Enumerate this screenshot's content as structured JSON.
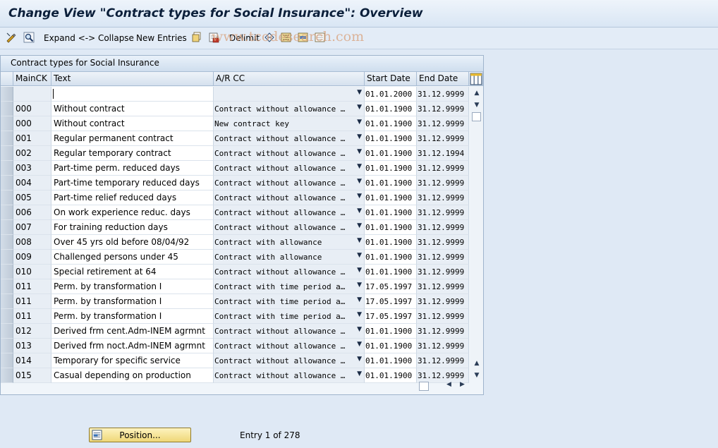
{
  "window": {
    "title": "Change View \"Contract types for Social Insurance\": Overview"
  },
  "toolbar": {
    "expand_collapse": "Expand <-> Collapse",
    "new_entries": "New Entries",
    "delimit": "Delimit"
  },
  "watermark": "www.tcodesearch.com",
  "table": {
    "title": "Contract types for Social Insurance",
    "columns": [
      "MainCK",
      "Text",
      "A/R CC",
      "Start Date",
      "End Date"
    ],
    "rows": [
      [
        "",
        "",
        "",
        "01.01.2000",
        "31.12.9999"
      ],
      [
        "000",
        "Without contract",
        "Contract without allowance …",
        "01.01.1900",
        "31.12.9999"
      ],
      [
        "000",
        "Without contract",
        "New contract key",
        "01.01.1900",
        "31.12.9999"
      ],
      [
        "001",
        "Regular permanent contract",
        "Contract without allowance …",
        "01.01.1900",
        "31.12.9999"
      ],
      [
        "002",
        "Regular temporary contract",
        "Contract without allowance …",
        "01.01.1900",
        "31.12.1994"
      ],
      [
        "003",
        "Part-time perm. reduced days",
        "Contract without allowance …",
        "01.01.1900",
        "31.12.9999"
      ],
      [
        "004",
        "Part-time temporary reduced days",
        "Contract without allowance …",
        "01.01.1900",
        "31.12.9999"
      ],
      [
        "005",
        "Part-time relief reduced days",
        "Contract without allowance …",
        "01.01.1900",
        "31.12.9999"
      ],
      [
        "006",
        "On work experience reduc. days",
        "Contract without allowance …",
        "01.01.1900",
        "31.12.9999"
      ],
      [
        "007",
        "For training reduction days",
        "Contract without allowance …",
        "01.01.1900",
        "31.12.9999"
      ],
      [
        "008",
        "Over 45 yrs old before 08/04/92",
        "Contract with allowance",
        "01.01.1900",
        "31.12.9999"
      ],
      [
        "009",
        "Challenged persons under 45",
        "Contract with allowance",
        "01.01.1900",
        "31.12.9999"
      ],
      [
        "010",
        "Special retirement at 64",
        "Contract without allowance …",
        "01.01.1900",
        "31.12.9999"
      ],
      [
        "011",
        "Perm. by transformation I",
        "Contract with time period a…",
        "17.05.1997",
        "31.12.9999"
      ],
      [
        "011",
        "Perm. by transformation I",
        "Contract with time period a…",
        "17.05.1997",
        "31.12.9999"
      ],
      [
        "011",
        "Perm. by transformation I",
        "Contract with time period a…",
        "17.05.1997",
        "31.12.9999"
      ],
      [
        "012",
        "Derived frm cent.Adm-INEM agrmnt",
        "Contract without allowance …",
        "01.01.1900",
        "31.12.9999"
      ],
      [
        "013",
        "Derived frm noct.Adm-INEM agrmnt",
        "Contract without allowance …",
        "01.01.1900",
        "31.12.9999"
      ],
      [
        "014",
        "Temporary for specific service",
        "Contract without allowance …",
        "01.01.1900",
        "31.12.9999"
      ],
      [
        "015",
        "Casual depending on production",
        "Contract without allowance …",
        "01.01.1900",
        "31.12.9999"
      ]
    ]
  },
  "footer": {
    "position_button": "Position...",
    "entry_info": "Entry 1 of 278"
  },
  "colors": {
    "background": "#dfe9f5",
    "position_button": "#f5e49a"
  }
}
